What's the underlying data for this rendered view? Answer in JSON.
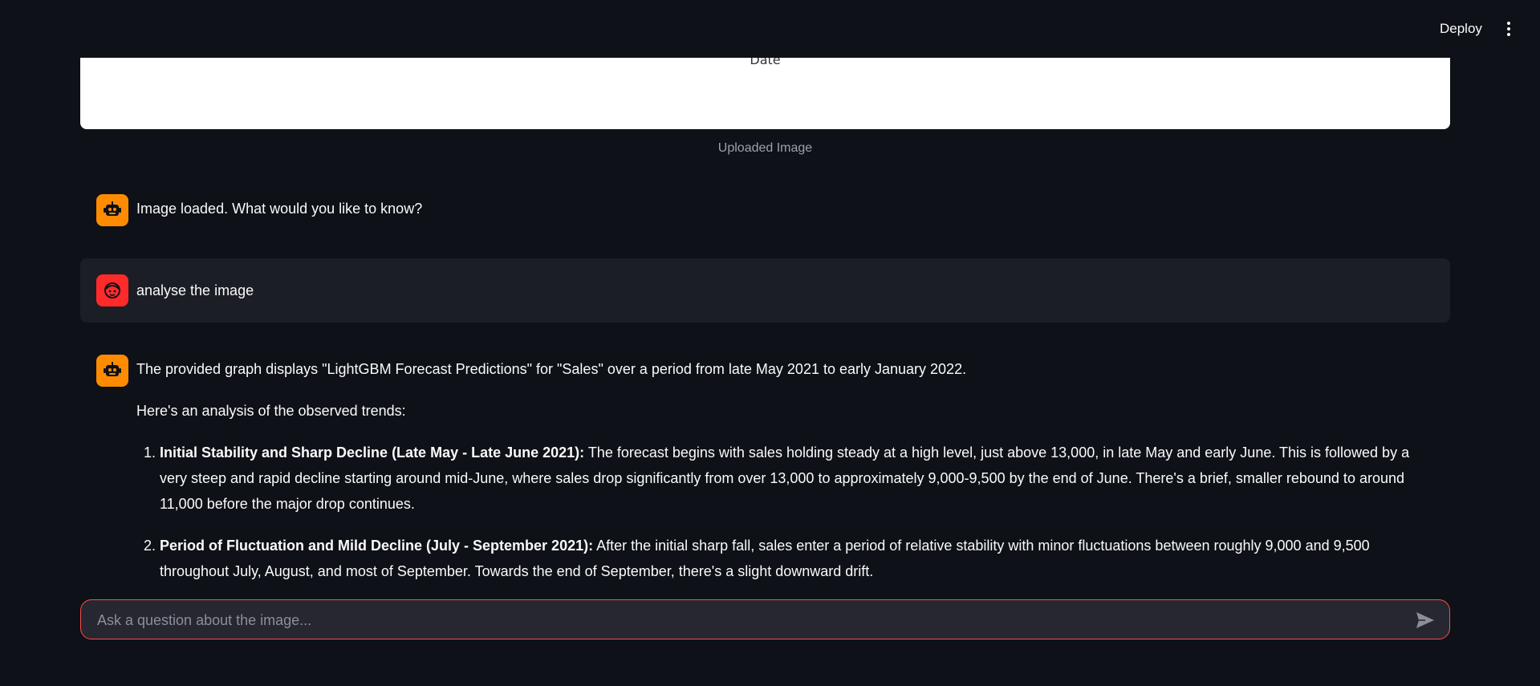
{
  "header": {
    "deploy_label": "Deploy"
  },
  "uploaded_image": {
    "visible_axis_label": "Date",
    "caption": "Uploaded Image"
  },
  "messages": [
    {
      "role": "assistant",
      "avatar_icon": "robot-icon",
      "text": "Image loaded. What would you like to know?"
    },
    {
      "role": "user",
      "avatar_icon": "user-face-icon",
      "text": "analyse the image"
    },
    {
      "role": "assistant",
      "avatar_icon": "robot-icon",
      "intro": "The provided graph displays \"LightGBM Forecast Predictions\" for \"Sales\" over a period from late May 2021 to early January 2022.",
      "lead": "Here's an analysis of the observed trends:",
      "points": [
        {
          "heading": "Initial Stability and Sharp Decline (Late May - Late June 2021):",
          "body": " The forecast begins with sales holding steady at a high level, just above 13,000, in late May and early June. This is followed by a very steep and rapid decline starting around mid-June, where sales drop significantly from over 13,000 to approximately 9,000-9,500 by the end of June. There's a brief, smaller rebound to around 11,000 before the major drop continues."
        },
        {
          "heading": "Period of Fluctuation and Mild Decline (July - September 2021):",
          "body": " After the initial sharp fall, sales enter a period of relative stability with minor fluctuations between roughly 9,000 and 9,500 throughout July, August, and most of September. Towards the end of September, there's a slight downward drift."
        }
      ]
    }
  ],
  "chat_input": {
    "placeholder": "Ask a question about the image..."
  },
  "colors": {
    "background": "#0e1117",
    "assistant_avatar": "#ff8c00",
    "user_avatar": "#ff2b2b",
    "input_border": "#ff4b4b"
  }
}
